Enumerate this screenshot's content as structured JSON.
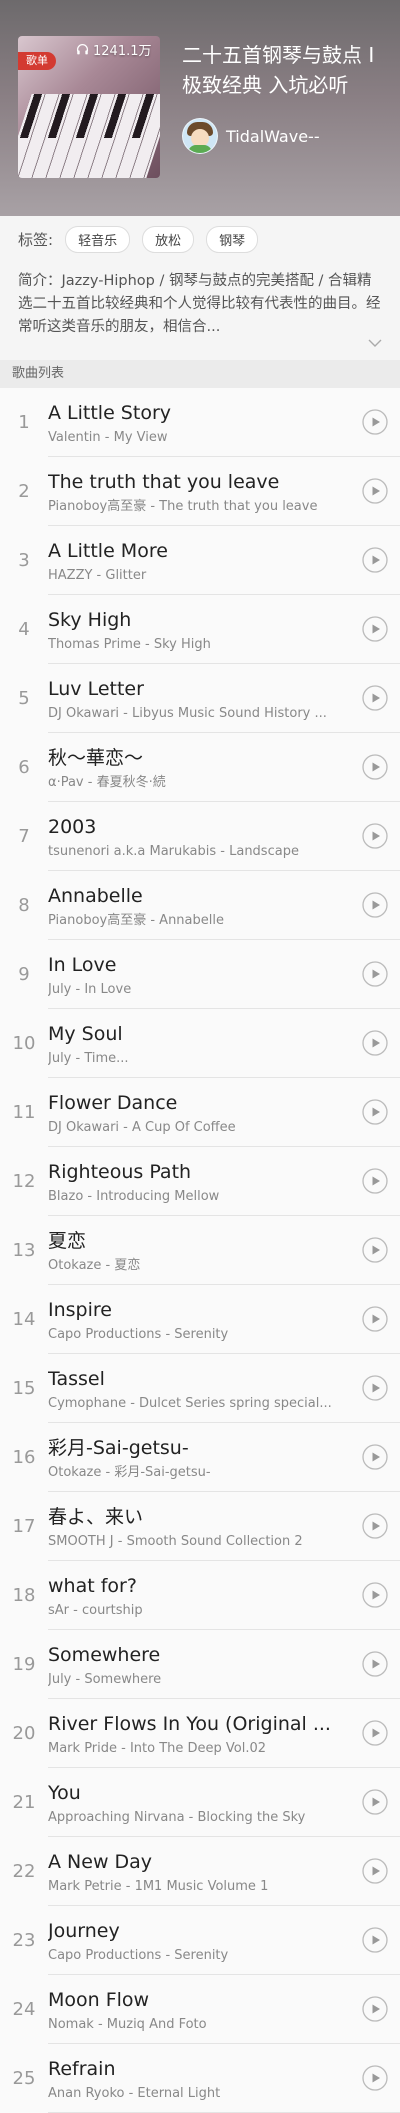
{
  "header": {
    "badge": "歌单",
    "play_count": "1241.1万",
    "title": "二十五首钢琴与鼓点 I 极致经典 入坑必听",
    "author": "TidalWave--"
  },
  "tags": {
    "label": "标签:",
    "items": [
      "轻音乐",
      "放松",
      "钢琴"
    ]
  },
  "intro": "简介：Jazzy-Hiphop / 钢琴与鼓点的完美搭配 / 合辑精选二十五首比较经典和个人觉得比较有代表性的曲目。经常听这类音乐的朋友，相信合...",
  "list_header": "歌曲列表",
  "songs": [
    {
      "idx": "1",
      "name": "A Little Story",
      "sub": "Valentin - My View"
    },
    {
      "idx": "2",
      "name": "The truth that you leave",
      "sub": "Pianoboy高至豪 - The truth that you leave"
    },
    {
      "idx": "3",
      "name": "A Little More",
      "sub": "HAZZY - Glitter"
    },
    {
      "idx": "4",
      "name": "Sky High",
      "sub": "Thomas Prime - Sky High"
    },
    {
      "idx": "5",
      "name": "Luv Letter",
      "sub": "DJ Okawari - Libyus Music Sound History ..."
    },
    {
      "idx": "6",
      "name": "秋～華恋～",
      "sub": "α·Pav - 春夏秋冬·続"
    },
    {
      "idx": "7",
      "name": "2003",
      "sub": "tsunenori a.k.a Marukabis - Landscape"
    },
    {
      "idx": "8",
      "name": "Annabelle",
      "sub": "Pianoboy高至豪 - Annabelle"
    },
    {
      "idx": "9",
      "name": "In Love",
      "sub": "July - In Love"
    },
    {
      "idx": "10",
      "name": "My Soul",
      "sub": "July - Time..."
    },
    {
      "idx": "11",
      "name": "Flower Dance",
      "sub": "DJ Okawari - A Cup Of Coffee"
    },
    {
      "idx": "12",
      "name": "Righteous Path",
      "sub": "Blazo - Introducing Mellow"
    },
    {
      "idx": "13",
      "name": "夏恋",
      "sub": "Otokaze - 夏恋"
    },
    {
      "idx": "14",
      "name": "Inspire",
      "sub": "Capo Productions - Serenity"
    },
    {
      "idx": "15",
      "name": "Tassel",
      "sub": "Cymophane - Dulcet Series spring special..."
    },
    {
      "idx": "16",
      "name": "彩月-Sai-getsu-",
      "sub": "Otokaze - 彩月-Sai-getsu-"
    },
    {
      "idx": "17",
      "name": "春よ、来い",
      "sub": "SMOOTH J - Smooth Sound Collection 2"
    },
    {
      "idx": "18",
      "name": "what for?",
      "sub": "sAr - courtship"
    },
    {
      "idx": "19",
      "name": "Somewhere",
      "sub": "July - Somewhere"
    },
    {
      "idx": "20",
      "name": "River Flows In You (Original ...",
      "sub": "Mark Pride - Into The Deep Vol.02"
    },
    {
      "idx": "21",
      "name": "You",
      "sub": "Approaching Nirvana - Blocking the Sky"
    },
    {
      "idx": "22",
      "name": "A New Day",
      "sub": "Mark Petrie - 1M1 Music Volume 1"
    },
    {
      "idx": "23",
      "name": "Journey",
      "sub": "Capo Productions - Serenity"
    },
    {
      "idx": "24",
      "name": "Moon Flow",
      "sub": "Nomak - Muziq And Foto"
    },
    {
      "idx": "25",
      "name": "Refrain",
      "sub": "Anan Ryoko - Eternal Light"
    }
  ]
}
